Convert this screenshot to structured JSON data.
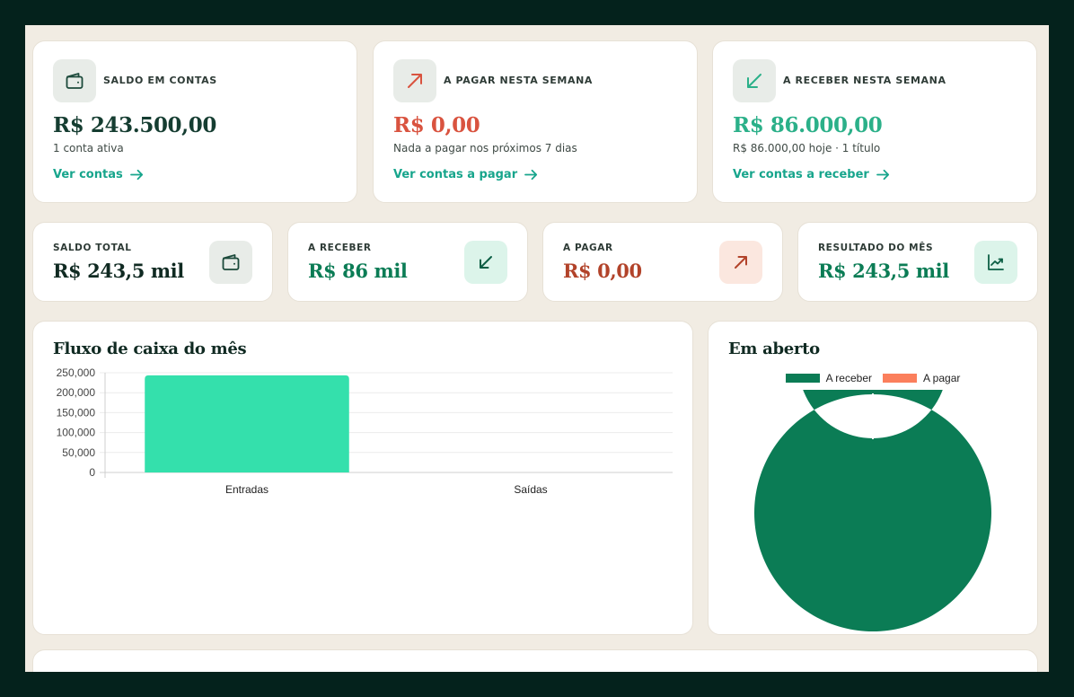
{
  "colors": {
    "dark_green": "#153d31",
    "red": "#d9533f",
    "teal": "#2bb089",
    "brown_red": "#b2432a",
    "green": "#0b7c55",
    "bar_green": "#34e0ac",
    "donut_green": "#0b7c55",
    "donut_orange": "#fb7f5c",
    "link": "#17a58c"
  },
  "summary_cards": [
    {
      "icon": "wallet-icon",
      "label": "SALDO EM CONTAS",
      "value": "R$ 243.500,00",
      "sub": "1 conta ativa",
      "link": "Ver contas"
    },
    {
      "icon": "arrow-up-right-icon",
      "label": "A PAGAR NESTA SEMANA",
      "value": "R$ 0,00",
      "sub": "Nada a pagar nos próximos 7 dias",
      "link": "Ver contas a pagar"
    },
    {
      "icon": "arrow-down-left-icon",
      "label": "A RECEBER NESTA SEMANA",
      "value": "R$ 86.000,00",
      "sub": "R$ 86.000,00 hoje · 1 título",
      "link": "Ver contas a receber"
    }
  ],
  "stat_cards": [
    {
      "icon": "wallet-icon",
      "label": "SALDO TOTAL",
      "value": "R$ 243,5 mil"
    },
    {
      "icon": "arrow-down-left-icon",
      "label": "A RECEBER",
      "value": "R$ 86 mil"
    },
    {
      "icon": "arrow-up-right-icon",
      "label": "A PAGAR",
      "value": "R$ 0,00"
    },
    {
      "icon": "trend-chart-icon",
      "label": "RESULTADO DO MÊS",
      "value": "R$ 243,5 mil"
    }
  ],
  "cashflow": {
    "title": "Fluxo de caixa do mês"
  },
  "open_panel": {
    "title": "Em aberto"
  },
  "chart_data": [
    {
      "type": "bar",
      "title": "Fluxo de caixa do mês",
      "categories": [
        "Entradas",
        "Saídas"
      ],
      "values": [
        243500,
        0
      ],
      "ylim": [
        0,
        250000
      ],
      "yticks": [
        "250,000",
        "200,000",
        "150,000",
        "100,000",
        "50,000",
        "0"
      ],
      "ytick_values": [
        250000,
        200000,
        150000,
        100000,
        50000,
        0
      ],
      "grid": true,
      "color": "#34e0ac"
    },
    {
      "type": "pie",
      "title": "Em aberto",
      "donut": true,
      "categories": [
        "A receber",
        "A pagar"
      ],
      "values": [
        86000,
        0
      ],
      "colors": [
        "#0b7c55",
        "#fb7f5c"
      ],
      "legend": "top"
    }
  ]
}
